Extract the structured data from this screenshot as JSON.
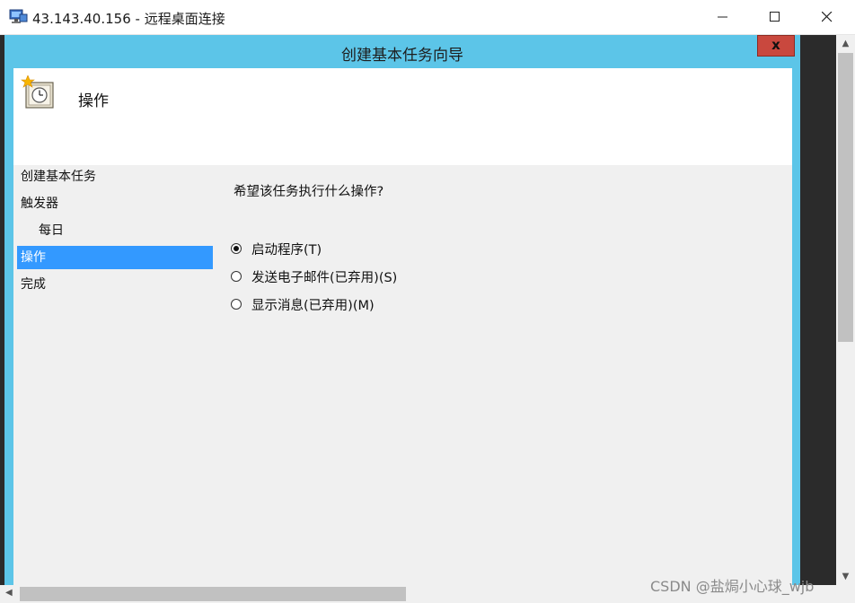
{
  "rdp_window": {
    "title": "43.143.40.156 - 远程桌面连接",
    "icon": "remote-desktop-icon"
  },
  "wizard": {
    "title": "创建基本任务向导",
    "close_label": "x",
    "header_title": "操作",
    "header_icon": "task-clock-icon",
    "nav": [
      {
        "label": "创建基本任务",
        "active": false
      },
      {
        "label": "触发器",
        "active": false
      },
      {
        "label": "每日",
        "active": false
      },
      {
        "label": "操作",
        "active": true
      },
      {
        "label": "完成",
        "active": false
      }
    ],
    "question": "希望该任务执行什么操作?",
    "options": [
      {
        "label": "启动程序(T)",
        "checked": true
      },
      {
        "label": "发送电子邮件(已弃用)(S)",
        "checked": false
      },
      {
        "label": "显示消息(已弃用)(M)",
        "checked": false
      }
    ]
  },
  "watermark": "CSDN @盐焗小心球_wjb",
  "colors": {
    "dialog_frame": "#5cc5e8",
    "selected_item": "#3399ff",
    "close_button": "#c9483e"
  }
}
